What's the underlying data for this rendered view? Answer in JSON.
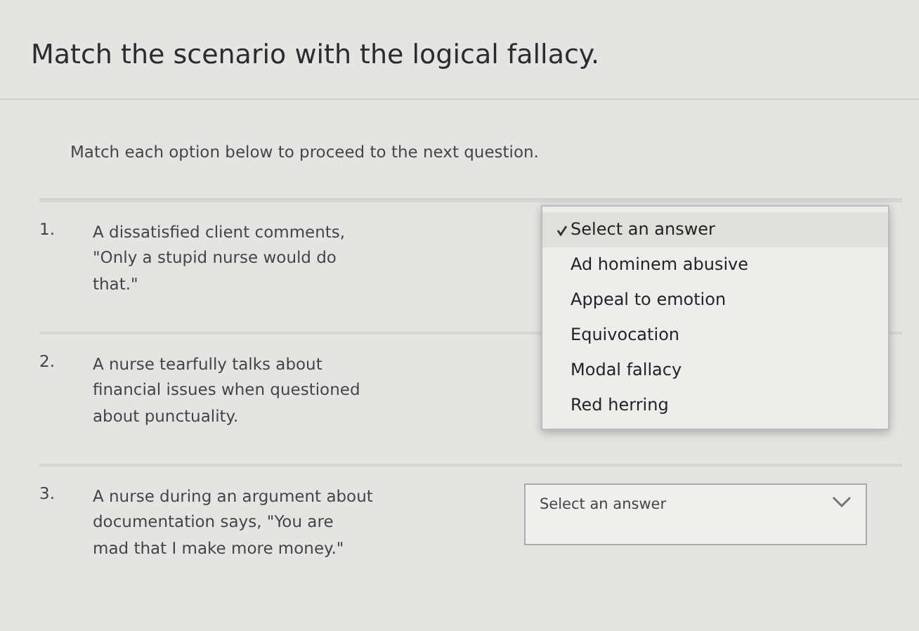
{
  "title": "Match the scenario with the logical fallacy.",
  "instructions": "Match each option below to proceed to the next question.",
  "questions": [
    {
      "number": "1.",
      "text": "A dissatisfied client comments, \"Only a stupid nurse would do that.\"",
      "menu": {
        "options": [
          {
            "label": "Select an answer",
            "selected": true
          },
          {
            "label": "Ad hominem abusive",
            "selected": false
          },
          {
            "label": "Appeal to emotion",
            "selected": false
          },
          {
            "label": "Equivocation",
            "selected": false
          },
          {
            "label": "Modal fallacy",
            "selected": false
          },
          {
            "label": "Red herring",
            "selected": false
          }
        ]
      }
    },
    {
      "number": "2.",
      "text": "A nurse tearfully talks about financial issues when questioned about punctuality."
    },
    {
      "number": "3.",
      "text": "A nurse during an argument about documentation says, \"You are mad that I make more money.\"",
      "select": {
        "value": "Select an answer"
      }
    }
  ]
}
